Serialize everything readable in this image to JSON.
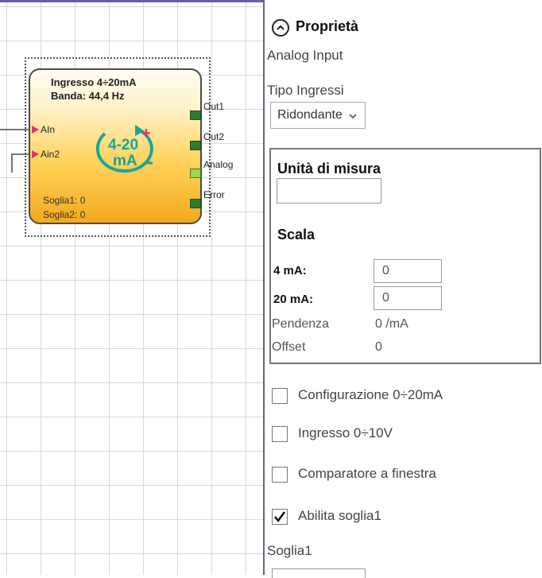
{
  "block": {
    "title": "Ingresso 4÷20mA",
    "band": "Banda: 44,4 Hz",
    "inputs": [
      "AIn",
      "Ain2"
    ],
    "outputs": [
      "Out1",
      "Out2",
      "Analog",
      "Error"
    ],
    "threshold1": "Soglia1: 0",
    "threshold2": "Soglia2: 0",
    "icon_text_top": "4-20",
    "icon_text_bottom": "mA"
  },
  "panel": {
    "title": "Proprietà",
    "subtitle": "Analog Input",
    "input_type_label": "Tipo Ingressi",
    "input_type_value": "Ridondante",
    "units_label": "Unità di misura",
    "units_value": "",
    "scale_label": "Scala",
    "ma4_label": "4 mA:",
    "ma4_value": "0",
    "ma20_label": "20 mA:",
    "ma20_value": "0",
    "slope_label": "Pendenza",
    "slope_value": "0 /mA",
    "offset_label": "Offset",
    "offset_value": "0",
    "checkboxes": [
      {
        "label": "Configurazione 0÷20mA",
        "checked": false
      },
      {
        "label": "Ingresso 0÷10V",
        "checked": false
      },
      {
        "label": "Comparatore a finestra",
        "checked": false
      },
      {
        "label": "Abilita soglia1",
        "checked": true
      }
    ],
    "threshold1_label": "Soglia1"
  },
  "colors": {
    "divider": "#6a5ea8",
    "block_gradient_bottom": "#f4a91c",
    "icon_teal": "#1aa59a",
    "icon_plus": "#e0336a",
    "pin_green": "#2e7d32"
  }
}
